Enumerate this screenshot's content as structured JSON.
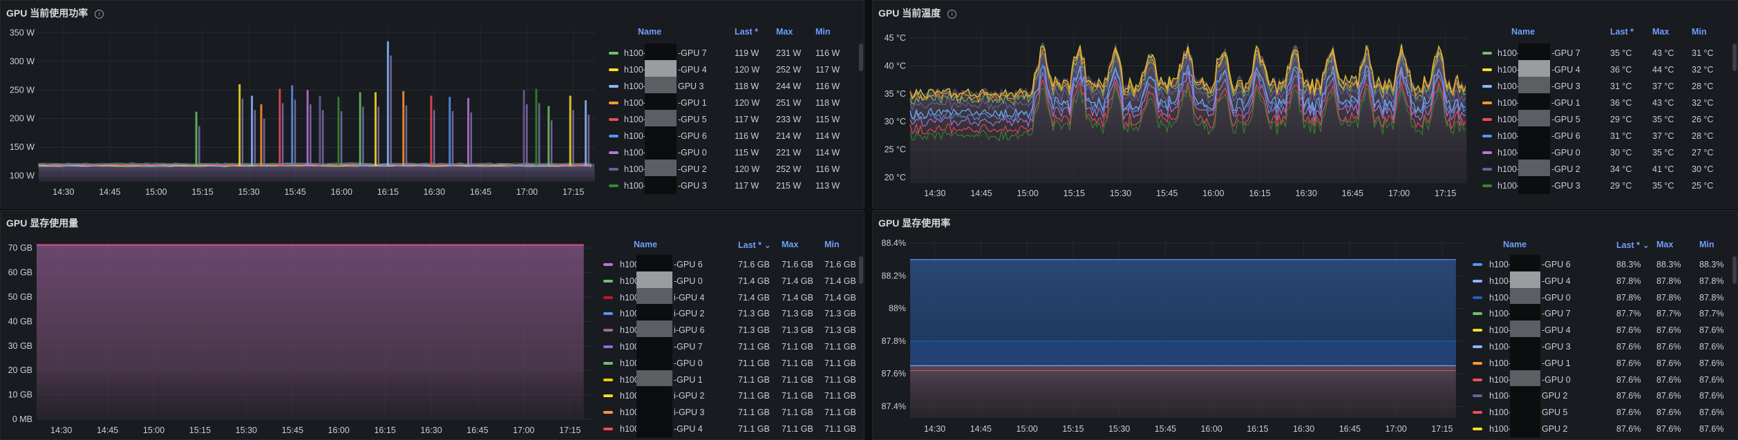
{
  "panels": [
    {
      "id": "power",
      "title": "GPU 当前使用功率",
      "has_info": true,
      "chart_data": {
        "type": "line",
        "ylim": [
          90,
          360
        ],
        "yticks": [
          "100 W",
          "150 W",
          "200 W",
          "250 W",
          "300 W",
          "350 W"
        ],
        "ytick_values": [
          100,
          150,
          200,
          250,
          300,
          350
        ],
        "xticks": [
          "14:30",
          "14:45",
          "15:00",
          "15:15",
          "15:30",
          "15:45",
          "16:00",
          "16:15",
          "16:30",
          "16:45",
          "17:00",
          "17:15"
        ],
        "x_start": "14:22",
        "x_end": "17:22",
        "baseline": 118,
        "spikes": [
          {
            "t": "15:13",
            "v": 212
          },
          {
            "t": "15:27",
            "v": 260
          },
          {
            "t": "15:31",
            "v": 240
          },
          {
            "t": "15:34",
            "v": 225
          },
          {
            "t": "15:40",
            "v": 252
          },
          {
            "t": "15:44",
            "v": 258
          },
          {
            "t": "15:49",
            "v": 250
          },
          {
            "t": "15:53",
            "v": 240
          },
          {
            "t": "15:59",
            "v": 238
          },
          {
            "t": "16:06",
            "v": 246
          },
          {
            "t": "16:11",
            "v": 246
          },
          {
            "t": "16:15",
            "v": 335
          },
          {
            "t": "16:20",
            "v": 248
          },
          {
            "t": "16:29",
            "v": 240
          },
          {
            "t": "16:35",
            "v": 238
          },
          {
            "t": "16:41",
            "v": 236
          },
          {
            "t": "16:59",
            "v": 250
          },
          {
            "t": "17:03",
            "v": 252
          },
          {
            "t": "17:07",
            "v": 222
          },
          {
            "t": "17:14",
            "v": 240
          },
          {
            "t": "17:19",
            "v": 232
          }
        ]
      },
      "legend": {
        "headers": [
          "Name",
          "Last *",
          "Max",
          "Min"
        ],
        "rows": [
          {
            "name_a": "h100-",
            "name_b": "-GPU 7",
            "last": "119 W",
            "max": "231 W",
            "min": "116 W",
            "color": "#73bf69"
          },
          {
            "name_a": "h100-",
            "name_b": "-GPU 4",
            "last": "120 W",
            "max": "252 W",
            "min": "117 W",
            "color": "#fade2a"
          },
          {
            "name_a": "h100-",
            "name_b": "GPU 3",
            "last": "118 W",
            "max": "244 W",
            "min": "116 W",
            "color": "#8ab8ff"
          },
          {
            "name_a": "h100-",
            "name_b": "-GPU 1",
            "last": "120 W",
            "max": "251 W",
            "min": "118 W",
            "color": "#ff9830"
          },
          {
            "name_a": "h100-",
            "name_b": "-GPU 5",
            "last": "117 W",
            "max": "233 W",
            "min": "115 W",
            "color": "#f2495c"
          },
          {
            "name_a": "h100-",
            "name_b": "-GPU 6",
            "last": "116 W",
            "max": "214 W",
            "min": "114 W",
            "color": "#5794f2"
          },
          {
            "name_a": "h100-",
            "name_b": "-GPU 0",
            "last": "115 W",
            "max": "221 W",
            "min": "114 W",
            "color": "#b877d9"
          },
          {
            "name_a": "h100-",
            "name_b": "-GPU 2",
            "last": "120 W",
            "max": "252 W",
            "min": "116 W",
            "color": "#705da0"
          },
          {
            "name_a": "h100-",
            "name_b": "-GPU 3",
            "last": "117 W",
            "max": "215 W",
            "min": "113 W",
            "color": "#37872d"
          }
        ]
      }
    },
    {
      "id": "temp",
      "title": "GPU 当前温度",
      "has_info": true,
      "chart_data": {
        "type": "line",
        "ylim": [
          19,
          47
        ],
        "yticks": [
          "20 °C",
          "25 °C",
          "30 °C",
          "35 °C",
          "40 °C",
          "45 °C"
        ],
        "ytick_values": [
          20,
          25,
          30,
          35,
          40,
          45
        ],
        "xticks": [
          "14:30",
          "14:45",
          "15:00",
          "15:15",
          "15:30",
          "15:45",
          "16:00",
          "16:15",
          "16:30",
          "16:45",
          "17:00",
          "17:15"
        ],
        "x_start": "14:22",
        "x_end": "17:22",
        "idle_band": [
          30,
          34.5
        ],
        "active_start": "15:02",
        "peak_level": 42
      },
      "legend": {
        "headers": [
          "Name",
          "Last *",
          "Max",
          "Min"
        ],
        "rows": [
          {
            "name_a": "h100-",
            "name_b": "-GPU 7",
            "last": "35 °C",
            "max": "43 °C",
            "min": "31 °C",
            "color": "#73bf69"
          },
          {
            "name_a": "h100-",
            "name_b": "-GPU 4",
            "last": "36 °C",
            "max": "44 °C",
            "min": "32 °C",
            "color": "#fade2a"
          },
          {
            "name_a": "h100-",
            "name_b": "-GPU 3",
            "last": "31 °C",
            "max": "37 °C",
            "min": "28 °C",
            "color": "#8ab8ff"
          },
          {
            "name_a": "h100-",
            "name_b": "-GPU 1",
            "last": "36 °C",
            "max": "43 °C",
            "min": "32 °C",
            "color": "#ff9830"
          },
          {
            "name_a": "h100-",
            "name_b": "-GPU 5",
            "last": "29 °C",
            "max": "35 °C",
            "min": "26 °C",
            "color": "#f2495c"
          },
          {
            "name_a": "h100-",
            "name_b": "-GPU 6",
            "last": "31 °C",
            "max": "37 °C",
            "min": "28 °C",
            "color": "#5794f2"
          },
          {
            "name_a": "h100-",
            "name_b": "-GPU 0",
            "last": "30 °C",
            "max": "35 °C",
            "min": "27 °C",
            "color": "#b877d9"
          },
          {
            "name_a": "h100-",
            "name_b": "-GPU 2",
            "last": "34 °C",
            "max": "41 °C",
            "min": "30 °C",
            "color": "#705da0"
          },
          {
            "name_a": "h100-",
            "name_b": "-GPU 3",
            "last": "29 °C",
            "max": "35 °C",
            "min": "25 °C",
            "color": "#37872d"
          }
        ]
      }
    },
    {
      "id": "mem",
      "title": "GPU 显存使用量",
      "has_info": false,
      "chart_data": {
        "type": "area",
        "ylim": [
          0,
          74
        ],
        "yticks": [
          "0 MB",
          "10 GB",
          "20 GB",
          "30 GB",
          "40 GB",
          "50 GB",
          "60 GB",
          "70 GB"
        ],
        "ytick_values": [
          0,
          10,
          20,
          30,
          40,
          50,
          60,
          70
        ],
        "xticks": [
          "14:30",
          "14:45",
          "15:00",
          "15:15",
          "15:30",
          "15:45",
          "16:00",
          "16:15",
          "16:30",
          "16:45",
          "17:00",
          "17:15"
        ],
        "x_start": "14:22",
        "x_end": "17:22",
        "level": 71.6
      },
      "legend": {
        "headers": [
          "Name",
          "Last * ⌄",
          "Max",
          "Min"
        ],
        "rows": [
          {
            "name_a": "h100-",
            "name_b": "-GPU 6",
            "last": "71.6 GB",
            "max": "71.6 GB",
            "min": "71.6 GB",
            "color": "#b877d9"
          },
          {
            "name_a": "h100-",
            "name_b": "-GPU 0",
            "last": "71.4 GB",
            "max": "71.4 GB",
            "min": "71.4 GB",
            "color": "#73bf69"
          },
          {
            "name_a": "h100-",
            "name_b": "i-GPU 4",
            "last": "71.4 GB",
            "max": "71.4 GB",
            "min": "71.4 GB",
            "color": "#c4162a"
          },
          {
            "name_a": "h100-",
            "name_b": "i-GPU 2",
            "last": "71.3 GB",
            "max": "71.3 GB",
            "min": "71.3 GB",
            "color": "#5794f2"
          },
          {
            "name_a": "h100-",
            "name_b": "i-GPU 6",
            "last": "71.3 GB",
            "max": "71.3 GB",
            "min": "71.3 GB",
            "color": "#a16a8a"
          },
          {
            "name_a": "h100",
            "name_b": "-GPU 7",
            "last": "71.1 GB",
            "max": "71.1 GB",
            "min": "71.1 GB",
            "color": "#9a6cd8"
          },
          {
            "name_a": "h100",
            "name_b": "-GPU 0",
            "last": "71.1 GB",
            "max": "71.1 GB",
            "min": "71.1 GB",
            "color": "#73bf69"
          },
          {
            "name_a": "h100",
            "name_b": "-GPU 1",
            "last": "71.1 GB",
            "max": "71.1 GB",
            "min": "71.1 GB",
            "color": "#f2cc0c"
          },
          {
            "name_a": "h100",
            "name_b": "i-GPU 2",
            "last": "71.1 GB",
            "max": "71.1 GB",
            "min": "71.1 GB",
            "color": "#fade2a"
          },
          {
            "name_a": "h100",
            "name_b": "i-GPU 3",
            "last": "71.1 GB",
            "max": "71.1 GB",
            "min": "71.1 GB",
            "color": "#ff9830"
          },
          {
            "name_a": "h100-",
            "name_b": "-GPU 4",
            "last": "71.1 GB",
            "max": "71.1 GB",
            "min": "71.1 GB",
            "color": "#f2495c"
          }
        ]
      }
    },
    {
      "id": "memrate",
      "title": "GPU 显存使用率",
      "has_info": false,
      "chart_data": {
        "type": "area",
        "ylim": [
          87.33,
          88.43
        ],
        "yticks": [
          "87.4%",
          "87.6%",
          "87.8%",
          "88%",
          "88.2%",
          "88.4%"
        ],
        "ytick_values": [
          87.4,
          87.6,
          87.8,
          88.0,
          88.2,
          88.4
        ],
        "xticks": [
          "14:30",
          "14:45",
          "15:00",
          "15:15",
          "15:30",
          "15:45",
          "16:00",
          "16:15",
          "16:30",
          "16:45",
          "17:00",
          "17:15"
        ],
        "x_start": "14:22",
        "x_end": "17:22",
        "levels": [
          88.3,
          87.8,
          87.65,
          87.62
        ]
      },
      "legend": {
        "headers": [
          "Name",
          "Last * ⌄",
          "Max",
          "Min"
        ],
        "rows": [
          {
            "name_a": "h100-l",
            "name_b": "-GPU 6",
            "last": "88.3%",
            "max": "88.3%",
            "min": "88.3%",
            "color": "#5794f2"
          },
          {
            "name_a": "h100-",
            "name_b": "-GPU 4",
            "last": "87.8%",
            "max": "87.8%",
            "min": "87.8%",
            "color": "#8ab8ff"
          },
          {
            "name_a": "h100-",
            "name_b": "-GPU 0",
            "last": "87.8%",
            "max": "87.8%",
            "min": "87.8%",
            "color": "#1f60c4"
          },
          {
            "name_a": "h100-",
            "name_b": "-GPU 7",
            "last": "87.7%",
            "max": "87.7%",
            "min": "87.7%",
            "color": "#73bf69"
          },
          {
            "name_a": "h100-",
            "name_b": "-GPU 4",
            "last": "87.6%",
            "max": "87.6%",
            "min": "87.6%",
            "color": "#fade2a"
          },
          {
            "name_a": "h100-",
            "name_b": "-GPU 3",
            "last": "87.6%",
            "max": "87.6%",
            "min": "87.6%",
            "color": "#8ab8ff"
          },
          {
            "name_a": "h100-",
            "name_b": "-GPU 1",
            "last": "87.6%",
            "max": "87.6%",
            "min": "87.6%",
            "color": "#ff9830"
          },
          {
            "name_a": "h100-",
            "name_b": "-GPU 0",
            "last": "87.6%",
            "max": "87.6%",
            "min": "87.6%",
            "color": "#f2495c"
          },
          {
            "name_a": "h100-",
            "name_b": "GPU 2",
            "last": "87.6%",
            "max": "87.6%",
            "min": "87.6%",
            "color": "#705da0"
          },
          {
            "name_a": "h100-",
            "name_b": "GPU 5",
            "last": "87.6%",
            "max": "87.6%",
            "min": "87.6%",
            "color": "#f2495c"
          },
          {
            "name_a": "h100-",
            "name_b": "GPU 2",
            "last": "87.6%",
            "max": "87.6%",
            "min": "87.6%",
            "color": "#fade2a"
          }
        ]
      }
    }
  ]
}
